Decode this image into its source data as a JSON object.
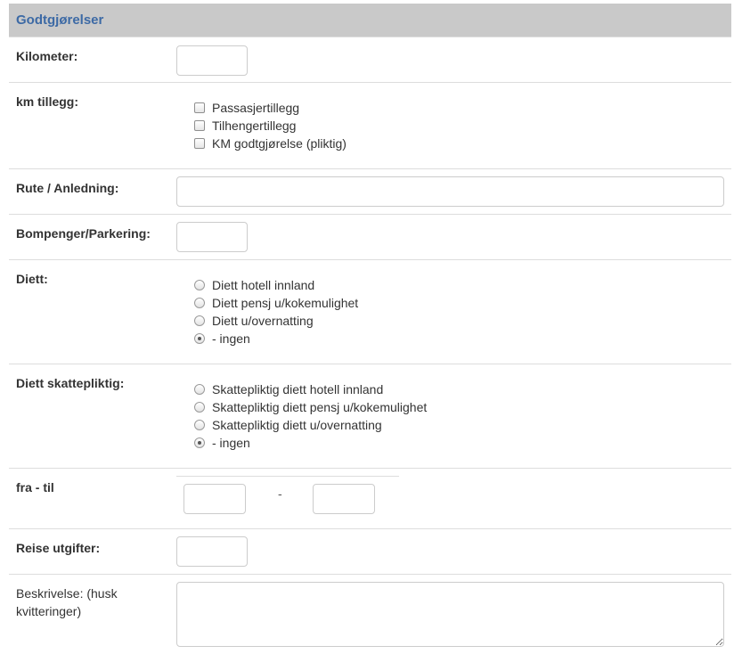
{
  "panel": {
    "title": "Godtgjørelser"
  },
  "kilometer": {
    "label": "Kilometer:",
    "value": ""
  },
  "km_tillegg": {
    "label": "km tillegg:",
    "options": [
      {
        "label": "Passasjertillegg",
        "checked": false
      },
      {
        "label": "Tilhengertillegg",
        "checked": false
      },
      {
        "label": "KM godtgjørelse (pliktig)",
        "checked": false
      }
    ]
  },
  "rute": {
    "label": "Rute / Anledning:",
    "value": ""
  },
  "bompenger": {
    "label": "Bompenger/Parkering:",
    "value": ""
  },
  "diett": {
    "label": "Diett:",
    "options": [
      {
        "label": "Diett hotell innland",
        "checked": false
      },
      {
        "label": "Diett pensj u/kokemulighet",
        "checked": false
      },
      {
        "label": "Diett u/overnatting",
        "checked": false
      },
      {
        "label": "- ingen",
        "checked": true
      }
    ]
  },
  "diett_skattepliktig": {
    "label": "Diett skattepliktig:",
    "options": [
      {
        "label": "Skattepliktig diett hotell innland",
        "checked": false
      },
      {
        "label": "Skattepliktig diett pensj u/kokemulighet",
        "checked": false
      },
      {
        "label": "Skattepliktig diett u/overnatting",
        "checked": false
      },
      {
        "label": "- ingen",
        "checked": true
      }
    ]
  },
  "fra_til": {
    "label": "fra - til",
    "separator": "-",
    "from_value": "",
    "to_value": ""
  },
  "reise_utgifter": {
    "label": "Reise utgifter:",
    "value": ""
  },
  "beskrivelse": {
    "label": "Beskrivelse: (husk kvitteringer)",
    "value": ""
  }
}
